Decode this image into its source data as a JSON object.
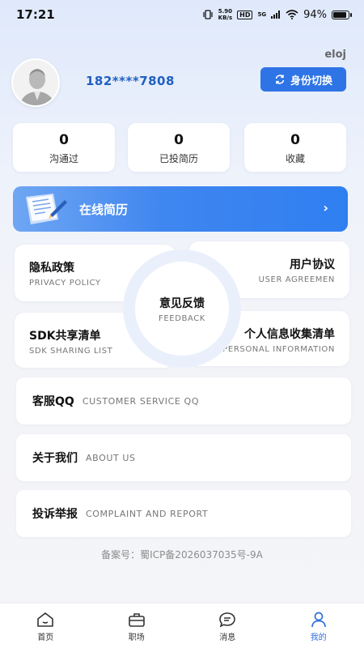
{
  "status": {
    "time": "17:21",
    "net_speed_top": "5.90",
    "net_speed_bottom": "KB/s",
    "hd": "HD",
    "signal": "5G",
    "battery": "94%",
    "battery_level": 0.94
  },
  "profile": {
    "corner_text": "eloj",
    "phone": "182****7808",
    "switch_label": "身份切换"
  },
  "stats": [
    {
      "value": "0",
      "label": "沟通过"
    },
    {
      "value": "0",
      "label": "已投简历"
    },
    {
      "value": "0",
      "label": "收藏"
    }
  ],
  "resume": {
    "label": "在线简历",
    "arrow": "›"
  },
  "grid": {
    "privacy": {
      "cn": "隐私政策",
      "en": "PRIVACY POLICY"
    },
    "agreement": {
      "cn": "用户协议",
      "en": "USER AGREEMEN"
    },
    "sdk": {
      "cn": "SDK共享清单",
      "en": "SDK SHARING LIST"
    },
    "personal": {
      "cn": "个人信息收集清单",
      "en": "PERSONAL INFORMATION"
    },
    "feedback": {
      "cn": "意见反馈",
      "en": "FEEDBACK"
    }
  },
  "rows": [
    {
      "cn": "客服QQ",
      "en": "CUSTOMER SERVICE QQ"
    },
    {
      "cn": "关于我们",
      "en": "ABOUT US"
    },
    {
      "cn": "投诉举报",
      "en": "COMPLAINT AND REPORT"
    }
  ],
  "icp": "备案号：蜀ICP备2026037035号-9A",
  "tabs": [
    {
      "label": "首页",
      "icon": "home-icon"
    },
    {
      "label": "职场",
      "icon": "briefcase-icon"
    },
    {
      "label": "消息",
      "icon": "message-icon"
    },
    {
      "label": "我的",
      "icon": "user-icon"
    }
  ],
  "colors": {
    "accent": "#2e74e6",
    "active_tab": "#2e6fd9"
  }
}
